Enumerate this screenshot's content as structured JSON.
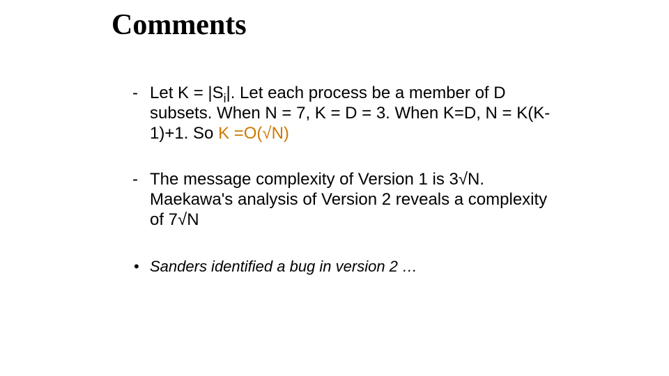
{
  "slide": {
    "title": "Comments",
    "items": [
      {
        "dash": "-",
        "prefix": "Let K = |S",
        "sub": "i",
        "mid": "|. Let each process be a member of D subsets. When N = 7, K = D = 3. When K=D, N = K(K-1)+1. So ",
        "highlight": "K =O(√N)"
      },
      {
        "dash": "-",
        "text": "The message complexity of Version 1 is 3√N. Maekawa's analysis of Version 2 reveals a complexity of 7√N"
      }
    ],
    "note": {
      "bullet": "•",
      "text": "Sanders identified a bug in version 2 …"
    }
  }
}
